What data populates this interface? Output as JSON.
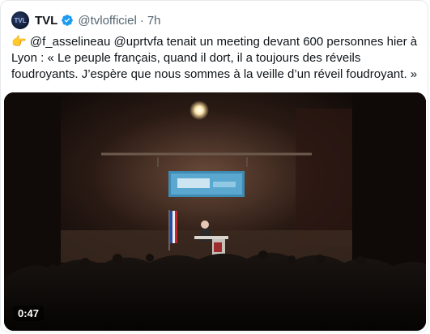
{
  "author": {
    "name": "TVL",
    "handle": "@tvlofficiel",
    "separator": "·",
    "time": "7h",
    "avatar_text": "TVL",
    "verified_color": "#1d9bf0"
  },
  "tweet": {
    "emoji": "👉",
    "mention1": "@f_asselineau",
    "mention2": "@uprtvfa",
    "text": " tenait un meeting devant 600 personnes hier à Lyon : « Le peuple français, quand il dort, il a toujours des réveils foudroyants. J’espère que nous sommes à la veille d’un réveil foudroyant. »"
  },
  "media": {
    "duration": "0:47",
    "icon": "play-video-icon"
  },
  "colors": {
    "text": "#0f1419",
    "secondary": "#536471",
    "link": "#0f1419"
  }
}
